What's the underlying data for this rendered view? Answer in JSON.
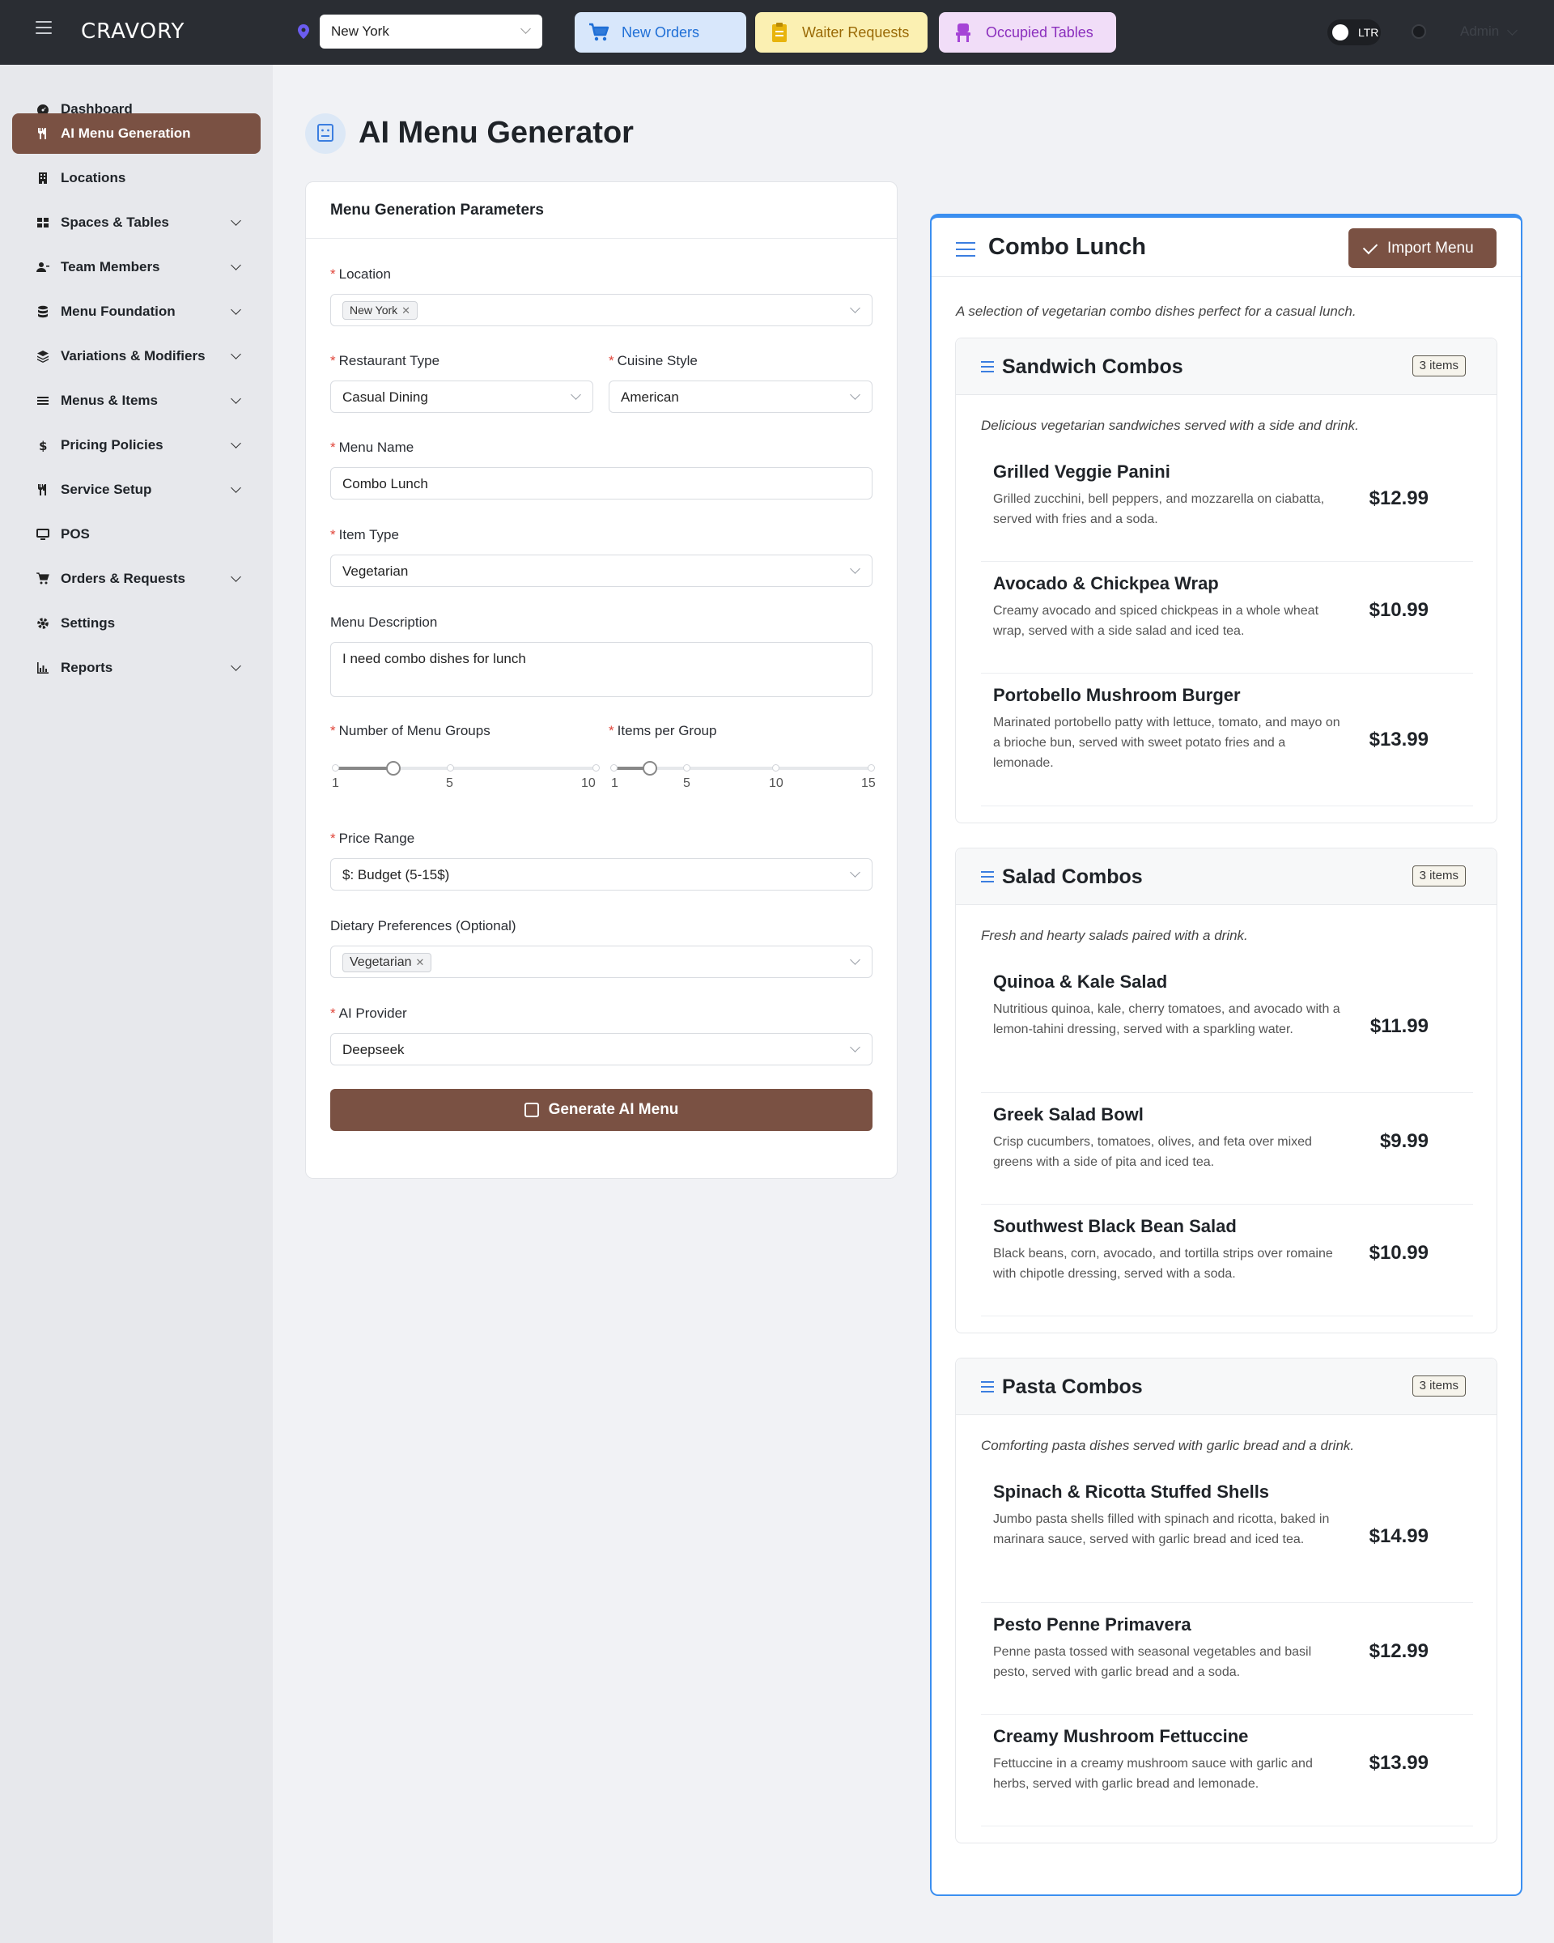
{
  "topbar": {
    "logo": "CRAVORY",
    "location_value": "New York",
    "pills": {
      "new_orders": "New Orders",
      "waiter_requests": "Waiter Requests",
      "occupied_tables": "Occupied Tables"
    },
    "direction_toggle": "LTR",
    "user": "Admin"
  },
  "sidebar": {
    "items": [
      {
        "label": "Dashboard"
      },
      {
        "label": "AI Menu Generation"
      },
      {
        "label": "Locations"
      },
      {
        "label": "Spaces & Tables"
      },
      {
        "label": "Team Members"
      },
      {
        "label": "Menu Foundation"
      },
      {
        "label": "Variations & Modifiers"
      },
      {
        "label": "Menus & Items"
      },
      {
        "label": "Pricing Policies"
      },
      {
        "label": "Service Setup"
      },
      {
        "label": "POS"
      },
      {
        "label": "Orders & Requests"
      },
      {
        "label": "Settings"
      },
      {
        "label": "Reports"
      }
    ]
  },
  "page": {
    "title": "AI Menu Generator"
  },
  "form": {
    "heading": "Menu Generation Parameters",
    "location_label": "Location",
    "location_tag": "New York",
    "restaurant_type_label": "Restaurant Type",
    "restaurant_type_value": "Casual Dining",
    "cuisine_style_label": "Cuisine Style",
    "cuisine_style_value": "American",
    "menu_name_label": "Menu Name",
    "menu_name_value": "Combo Lunch",
    "item_type_label": "Item Type",
    "item_type_value": "Vegetarian",
    "menu_description_label": "Menu Description",
    "menu_description_value": "I need combo dishes for lunch",
    "groups_label": "Number of Menu Groups",
    "groups_marks": [
      "1",
      "5",
      "10"
    ],
    "groups_value": 3,
    "items_label": "Items per Group",
    "items_marks": [
      "1",
      "5",
      "10",
      "15"
    ],
    "items_value": 3,
    "price_range_label": "Price Range",
    "price_range_value": "$: Budget (5-15$)",
    "dietary_label": "Dietary Preferences (Optional)",
    "dietary_tag": "Vegetarian",
    "ai_provider_label": "AI Provider",
    "ai_provider_value": "Deepseek",
    "generate_button": "Generate AI Menu"
  },
  "result": {
    "title": "Combo Lunch",
    "import_button": "Import Menu",
    "description": "A selection of vegetarian combo dishes perfect for a casual lunch.",
    "groups": [
      {
        "title": "Sandwich Combos",
        "badge": "3 items",
        "description": "Delicious vegetarian sandwiches served with a side and drink.",
        "items": [
          {
            "name": "Grilled Veggie Panini",
            "description": "Grilled zucchini, bell peppers, and mozzarella on ciabatta, served with fries and a soda.",
            "price": "$12.99"
          },
          {
            "name": "Avocado & Chickpea Wrap",
            "description": "Creamy avocado and spiced chickpeas in a whole wheat wrap, served with a side salad and iced tea.",
            "price": "$10.99"
          },
          {
            "name": "Portobello Mushroom Burger",
            "description": "Marinated portobello patty with lettuce, tomato, and mayo on a brioche bun, served with sweet potato fries and a lemonade.",
            "price": "$13.99"
          }
        ]
      },
      {
        "title": "Salad Combos",
        "badge": "3 items",
        "description": "Fresh and hearty salads paired with a drink.",
        "items": [
          {
            "name": "Quinoa & Kale Salad",
            "description": "Nutritious quinoa, kale, cherry tomatoes, and avocado with a lemon-tahini dressing, served with a sparkling water.",
            "price": "$11.99"
          },
          {
            "name": "Greek Salad Bowl",
            "description": "Crisp cucumbers, tomatoes, olives, and feta over mixed greens with a side of pita and iced tea.",
            "price": "$9.99"
          },
          {
            "name": "Southwest Black Bean Salad",
            "description": "Black beans, corn, avocado, and tortilla strips over romaine with chipotle dressing, served with a soda.",
            "price": "$10.99"
          }
        ]
      },
      {
        "title": "Pasta Combos",
        "badge": "3 items",
        "description": "Comforting pasta dishes served with garlic bread and a drink.",
        "items": [
          {
            "name": "Spinach & Ricotta Stuffed Shells",
            "description": "Jumbo pasta shells filled with spinach and ricotta, baked in marinara sauce, served with garlic bread and iced tea.",
            "price": "$14.99"
          },
          {
            "name": "Pesto Penne Primavera",
            "description": "Penne pasta tossed with seasonal vegetables and basil pesto, served with garlic bread and a soda.",
            "price": "$12.99"
          },
          {
            "name": "Creamy Mushroom Fettuccine",
            "description": "Fettuccine in a creamy mushroom sauce with garlic and herbs, served with garlic bread and lemonade.",
            "price": "$13.99"
          }
        ]
      }
    ]
  },
  "colors": {
    "topbar": "#2a2d33",
    "accent_brown": "#7a5143",
    "result_border": "#3b8ff0",
    "required": "#e0453a"
  }
}
